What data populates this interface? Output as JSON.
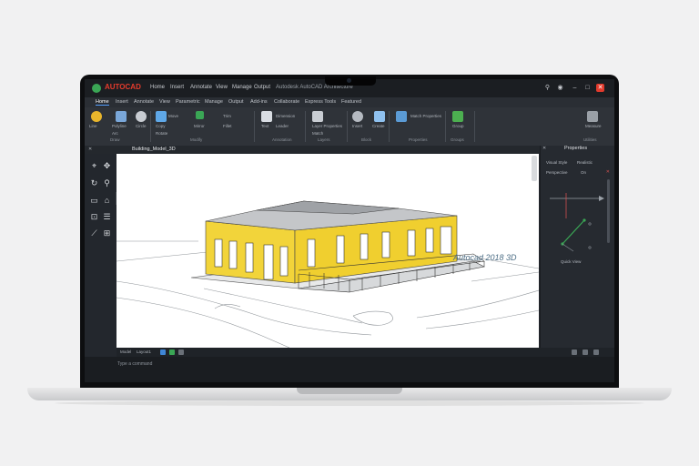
{
  "app": {
    "name": "AUTOCAD",
    "title": "Autodesk AutoCAD Architecture",
    "brand_color": "#e53b2c"
  },
  "window_controls": [
    "search-icon",
    "user-icon",
    "minimize",
    "maximize",
    "close"
  ],
  "menu": [
    "Home",
    "Insert",
    "Annotate",
    "View",
    "Manage",
    "Output"
  ],
  "ribbon_tabs": [
    "Home",
    "Insert",
    "Annotate",
    "View",
    "Parametric",
    "Manage",
    "Output",
    "Add-ins",
    "Collaborate",
    "Express Tools",
    "Featured"
  ],
  "ribbon_groups": [
    {
      "label": "Draw",
      "buttons": [
        "Line",
        "Polyline",
        "Circle",
        "Arc"
      ]
    },
    {
      "label": "Modify",
      "buttons": [
        "Move",
        "Copy",
        "Rotate",
        "Mirror",
        "Trim",
        "Fillet"
      ]
    },
    {
      "label": "Annotation",
      "buttons": [
        "Text",
        "Dimension",
        "Leader"
      ]
    },
    {
      "label": "Layers",
      "buttons": [
        "Layer Properties",
        "Match"
      ]
    },
    {
      "label": "Block",
      "buttons": [
        "Insert",
        "Create"
      ]
    },
    {
      "label": "Properties",
      "buttons": [
        "Match Properties"
      ]
    },
    {
      "label": "Groups",
      "buttons": [
        "Group"
      ]
    },
    {
      "label": "Utilities",
      "buttons": [
        "Measure"
      ]
    }
  ],
  "document_tab": "Building_Model_3D",
  "viewport": {
    "watermark": "Autocad 2018 3D"
  },
  "right_panel": {
    "title": "Properties",
    "rows": [
      {
        "label": "Visual Style",
        "value": "Realistic"
      },
      {
        "label": "Perspective",
        "value": "On"
      }
    ],
    "caption": "Quick View"
  },
  "status_bar": {
    "model_tab": "Model",
    "layout_tab": "Layout1",
    "command_prompt": "Type a command"
  },
  "colors": {
    "wall_yellow": "#f2d43a",
    "roof_gray": "#b7b9bc",
    "ui_dark": "#23272d"
  }
}
